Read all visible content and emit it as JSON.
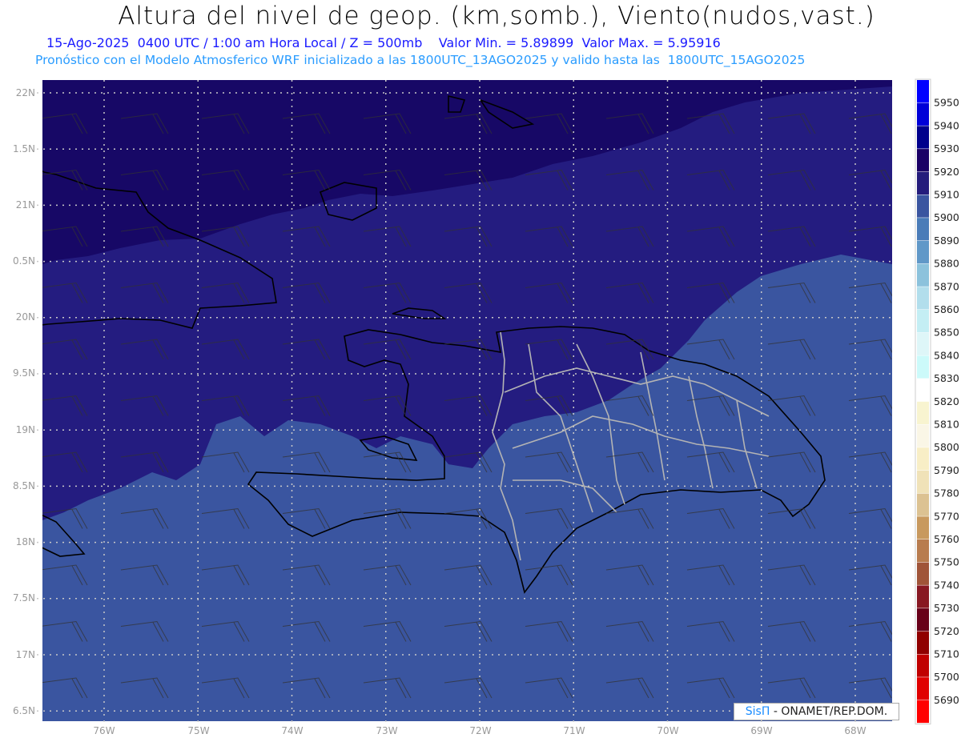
{
  "header": {
    "title": "Altura del nivel de geop. (km,somb.), Viento(nudos,vast.)",
    "line1": "15-Ago-2025  0400 UTC / 1:00 am Hora Local / Z = 500mb    Valor Min. = 5.89899  Valor Max. = 5.95916",
    "line2": "Pronóstico con el Modelo Atmosferico WRF inicializado a las 1800UTC_13AGO2025 y valido hasta las  1800UTC_15AGO2025"
  },
  "axes": {
    "lat_labels": [
      "22N",
      "1.5N",
      "21N",
      "0.5N",
      "20N",
      "9.5N",
      "19N",
      "8.5N",
      "18N",
      "7.5N",
      "17N",
      "6.5N"
    ],
    "lon_labels": [
      "76W",
      "75W",
      "74W",
      "73W",
      "72W",
      "71W",
      "70W",
      "69W",
      "68W"
    ]
  },
  "field_colors": {
    "level_5920": "#170866",
    "level_5910": "#241c80",
    "level_5900": "#3a55a0"
  },
  "colorbar": {
    "labels": [
      "5950",
      "5940",
      "5930",
      "5920",
      "5910",
      "5900",
      "5890",
      "5880",
      "5870",
      "5860",
      "5850",
      "5840",
      "5830",
      "5820",
      "5810",
      "5800",
      "5790",
      "5780",
      "5770",
      "5760",
      "5750",
      "5740",
      "5730",
      "5720",
      "5710",
      "5700",
      "5690"
    ],
    "colors": [
      "#0000ff",
      "#0000d8",
      "#00008c",
      "#1a0066",
      "#241c7c",
      "#3a55a0",
      "#4a7cb8",
      "#6098c8",
      "#8cc2dc",
      "#b2deec",
      "#c4eef4",
      "#def6f8",
      "#ccfafa",
      "#ffffff",
      "#f8f4d0",
      "#faf6e6",
      "#f8eec6",
      "#f0e2b8",
      "#dcc292",
      "#c8995e",
      "#b87c4e",
      "#a05438",
      "#881822",
      "#680018",
      "#900000",
      "#c00000",
      "#e00000",
      "#ff0000"
    ]
  },
  "credit": {
    "logo": "SisΠ",
    "text": " - ONAMET/REP.DOM."
  }
}
